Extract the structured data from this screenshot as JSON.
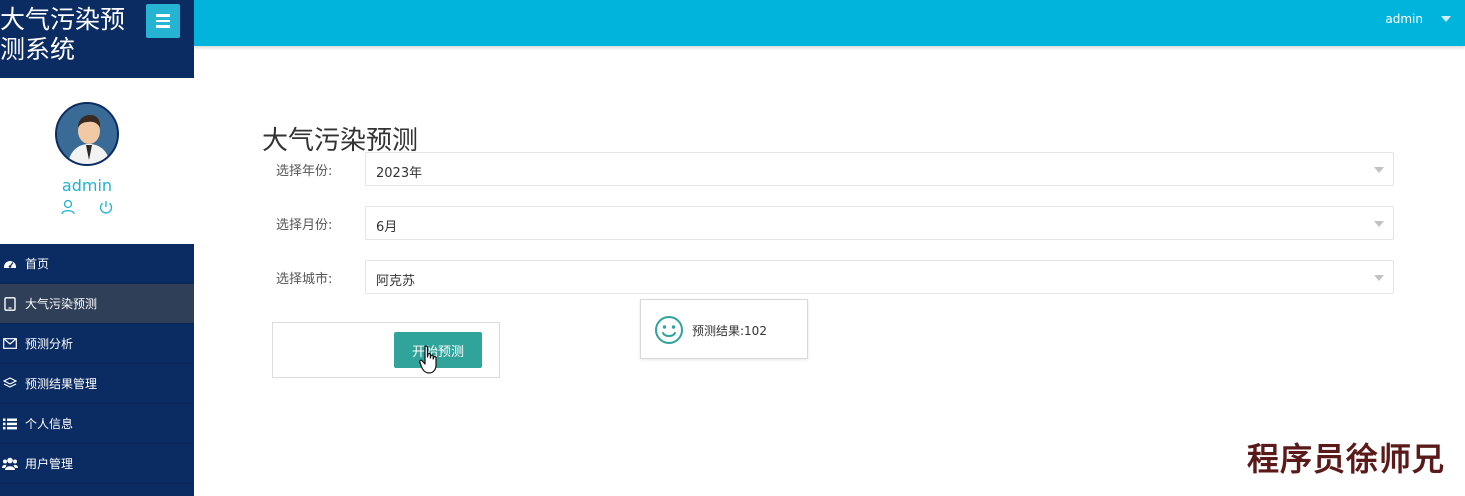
{
  "app": {
    "title": "大气污染预测系统"
  },
  "header": {
    "username": "admin"
  },
  "profile": {
    "name": "admin"
  },
  "sidebar": {
    "items": [
      {
        "label": "首页",
        "icon": "dashboard-icon"
      },
      {
        "label": "大气污染预测",
        "icon": "tablet-icon",
        "active": true
      },
      {
        "label": "预测分析",
        "icon": "envelope-icon"
      },
      {
        "label": "预测结果管理",
        "icon": "layers-icon"
      },
      {
        "label": "个人信息",
        "icon": "list-icon"
      },
      {
        "label": "用户管理",
        "icon": "users-icon"
      }
    ]
  },
  "page": {
    "title": "大气污染预测"
  },
  "form": {
    "year_label": "选择年份:",
    "year_value": "2023年",
    "month_label": "选择月份:",
    "month_value": "6月",
    "city_label": "选择城市:",
    "city_value": "阿克苏",
    "start_button": "开始预测"
  },
  "result": {
    "text": "预测结果:102"
  },
  "watermark": "程序员徐师兄",
  "colors": {
    "sidebar_dark": "#0b2b63",
    "header": "#00b4dc",
    "accent_button": "#30a39a",
    "toggle_button": "#25b5d3",
    "profile_name": "#1fb3d0"
  }
}
